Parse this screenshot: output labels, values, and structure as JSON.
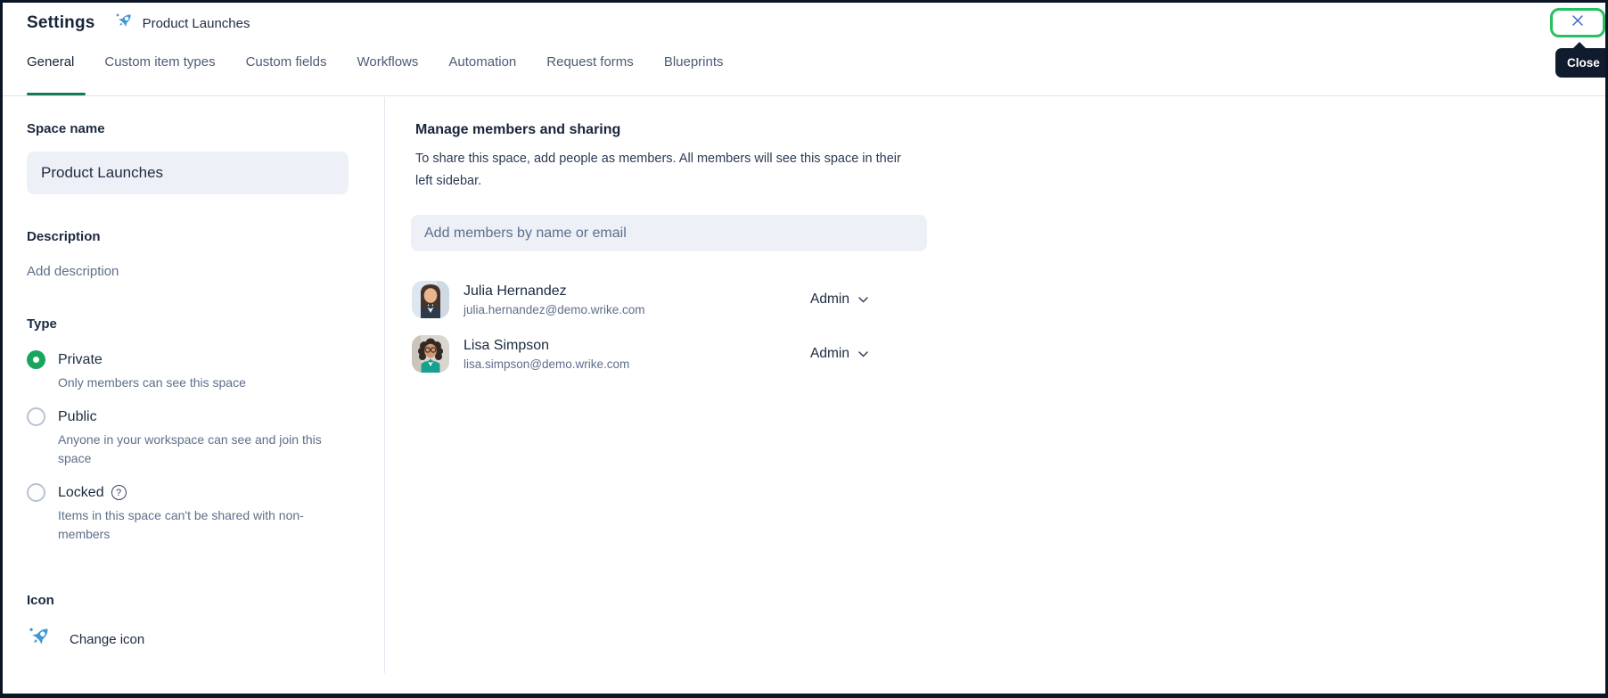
{
  "header": {
    "title": "Settings",
    "space_name": "Product Launches"
  },
  "tabs": [
    {
      "label": "General",
      "active": true
    },
    {
      "label": "Custom item types",
      "active": false
    },
    {
      "label": "Custom fields",
      "active": false
    },
    {
      "label": "Workflows",
      "active": false
    },
    {
      "label": "Automation",
      "active": false
    },
    {
      "label": "Request forms",
      "active": false
    },
    {
      "label": "Blueprints",
      "active": false
    }
  ],
  "close": {
    "tooltip": "Close"
  },
  "left_panel": {
    "space_name_label": "Space name",
    "space_name_value": "Product Launches",
    "description_label": "Description",
    "add_description_label": "Add description",
    "type_label": "Type",
    "type_options": [
      {
        "label": "Private",
        "description": "Only members can see this space",
        "selected": true
      },
      {
        "label": "Public",
        "description": "Anyone in your workspace can see and join this space",
        "selected": false
      },
      {
        "label": "Locked",
        "description": "Items in this space can't be shared with non-members",
        "selected": false,
        "help_glyph": "?"
      }
    ],
    "icon_label": "Icon",
    "change_icon_label": "Change icon"
  },
  "right_panel": {
    "heading": "Manage members and sharing",
    "description": "To share this space, add people as members. All members will see this space in their left sidebar.",
    "add_members_placeholder": "Add members by name or email",
    "members": [
      {
        "name": "Julia Hernandez",
        "email": "julia.hernandez@demo.wrike.com",
        "role": "Admin"
      },
      {
        "name": "Lisa Simpson",
        "email": "lisa.simpson@demo.wrike.com",
        "role": "Admin"
      }
    ]
  },
  "icons": {
    "space_icon": "rocket-icon",
    "close_icon": "x-icon",
    "help_icon": "question-mark-icon",
    "role_dropdown_icon": "chevron-down-icon"
  },
  "colors": {
    "active_tab_underline": "#13795a",
    "radio_selected_green": "#16a65c",
    "close_border_green": "#25c163",
    "rocket_blue": "#3f97d6",
    "input_background": "#edf1f7",
    "tooltip_background": "#101b2d",
    "primary_text": "#1b2a40",
    "secondary_text": "#5d6f8a",
    "window_border": "#0c1526"
  }
}
